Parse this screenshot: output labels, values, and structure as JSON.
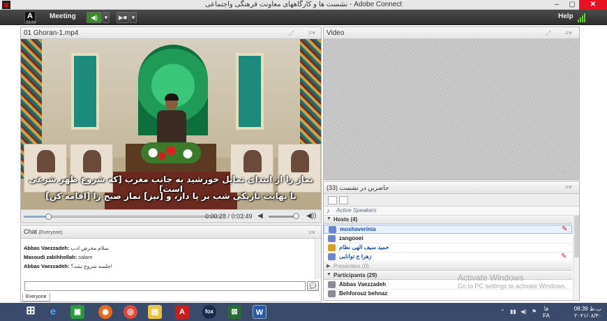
{
  "window": {
    "title": "نشست ها و کارگاههای معاونت فرهنگی واجتماعی - Adobe Connect",
    "min": "–",
    "max": "▢",
    "close": "✕"
  },
  "toolbar": {
    "logo": "Adobe",
    "meeting": "Meeting",
    "help": "Help",
    "speaker_icon": "speaker-icon",
    "camera_icon": "camera-icon",
    "dropdown": "▾"
  },
  "file_pod": {
    "title": "01 Ghoran-1.mp4",
    "subtitle_line1": "نماز را از ابتدای تمایل خورشید به جانب مغرب [که شروع ظهر شرعی است]",
    "subtitle_line2": "تا نهایت تاریکی شب بر پا دار، و [نیز] نماز صبح را [اقامه کن]",
    "time": "0:00:28 / 0:03:49",
    "progress": 0.122
  },
  "video_pod": {
    "title": "Video"
  },
  "attendees_pod": {
    "title": "حاضرین در نشست",
    "count": "(33)",
    "active_speakers": "Active Speakers",
    "hosts": "Hosts (4)",
    "presenters": "Presenters (0)",
    "participants": "Participants (29)",
    "host_list": [
      {
        "name": "moshaverinia",
        "flag": true
      },
      {
        "name": "zangooei",
        "flag": false
      },
      {
        "name": "حمید سیف الهی نظام",
        "flag": false
      },
      {
        "name": "زهرا ج توانایی",
        "flag": true
      }
    ],
    "participant_list": [
      {
        "name": "Abbas Vaezzadeh"
      },
      {
        "name": "Behforouz behnaz"
      }
    ]
  },
  "chat_pod": {
    "title": "Chat",
    "scope": "(Everyone)",
    "messages": [
      {
        "sender": "Abbas Vaezzadeh:",
        "text": "سلام محرض ادب"
      },
      {
        "sender": "Masoudi zabihhollah:",
        "text": "salam"
      },
      {
        "sender": "Abbas Vaezzadeh:",
        "text": "جلسه شروع نشد؟!"
      }
    ],
    "tab": "Everyone",
    "input_value": ""
  },
  "watermark": {
    "line1": "Activate Windows",
    "line2": "Go to PC settings to activate Windows."
  },
  "taskbar": {
    "lang": "فا",
    "lang2": "FA",
    "time": "08:39 ب.ظ",
    "date": "۲۰۲۱/۰۸/۳۰"
  }
}
